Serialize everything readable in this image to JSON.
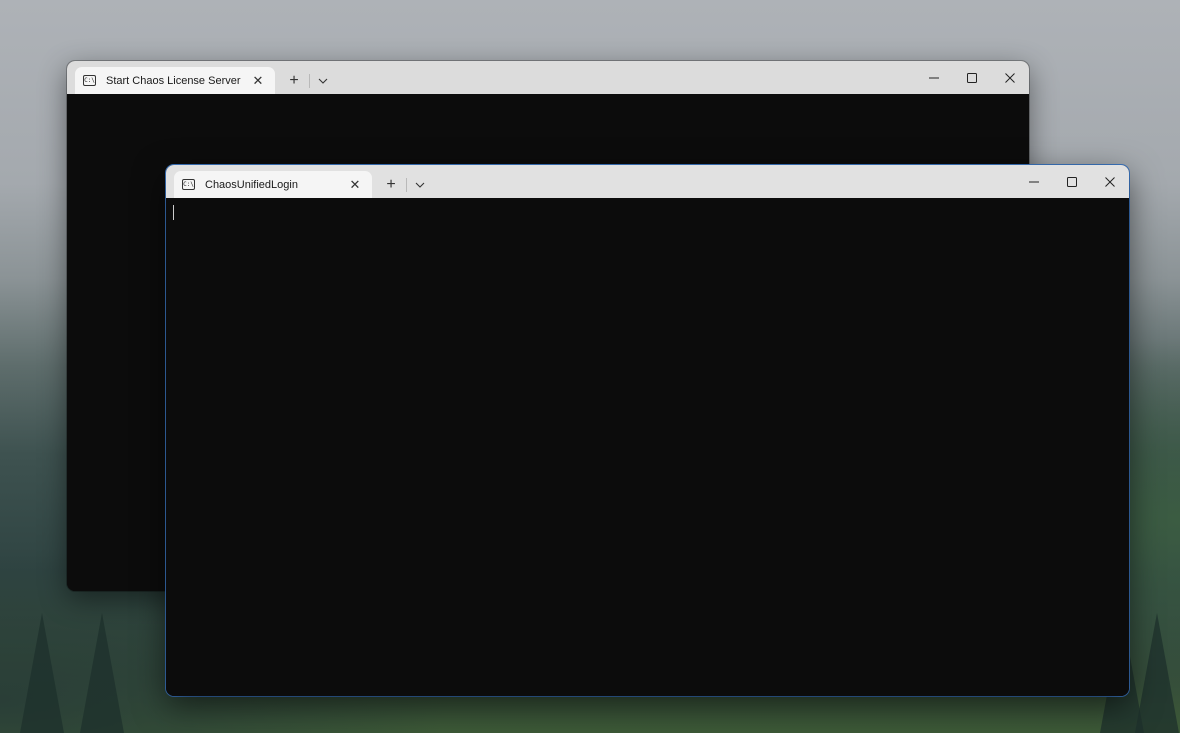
{
  "windows": {
    "back": {
      "tab_title": "Start Chaos License Server",
      "tab_icon": "command-prompt-icon"
    },
    "front": {
      "tab_title": "ChaosUnifiedLogin",
      "tab_icon": "command-prompt-icon"
    }
  },
  "glyphs": {
    "tab_icon_text": "C:\\",
    "close": "✕",
    "new_tab": "+"
  },
  "colors": {
    "terminal_bg": "#0c0c0c",
    "titlebar_bg": "#e1e1e1",
    "tab_active_bg": "#f5f5f5",
    "focus_border": "#3d78c4"
  }
}
